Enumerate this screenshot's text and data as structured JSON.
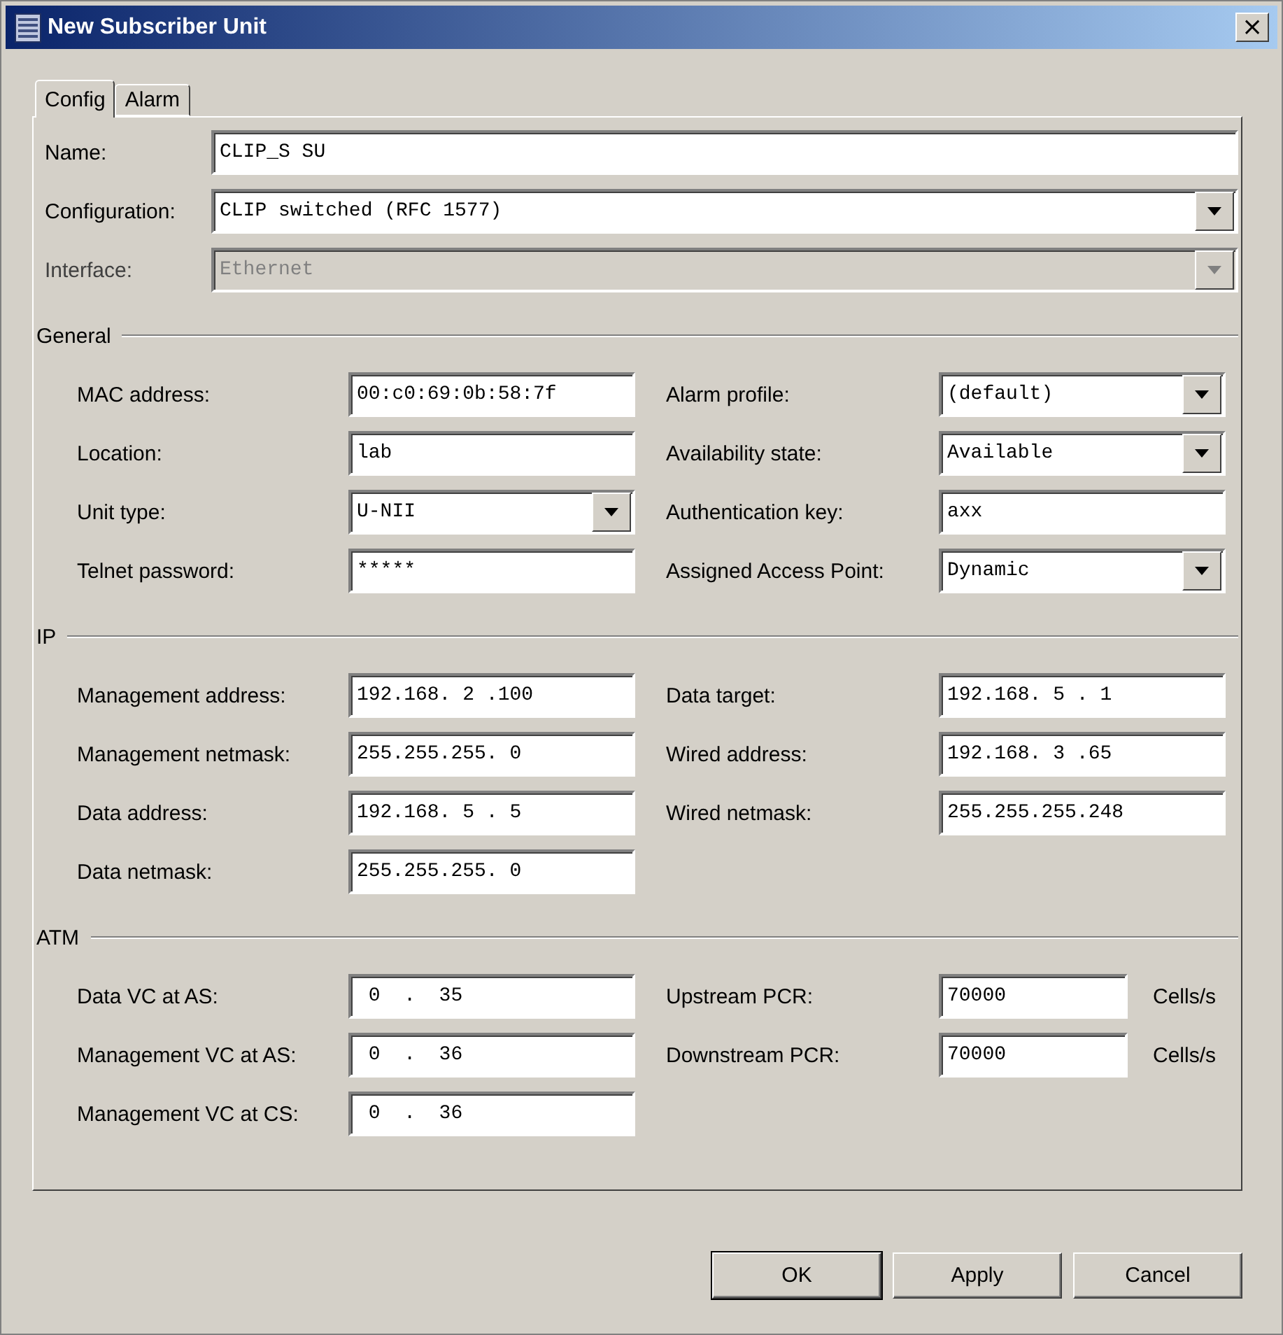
{
  "window": {
    "title": "New Subscriber Unit",
    "close": "×"
  },
  "tabs": [
    {
      "label": "Config",
      "selected": true
    },
    {
      "label": "Alarm",
      "selected": false
    }
  ],
  "top_fields": [
    {
      "label": "Name:",
      "kind": "text",
      "value": "CLIP_S SU",
      "disabled": false
    },
    {
      "label": "Configuration:",
      "kind": "combo",
      "value": "CLIP switched (RFC 1577)",
      "disabled": false
    },
    {
      "label": "Interface:",
      "kind": "combo",
      "value": "Ethernet",
      "disabled": true
    }
  ],
  "sections": [
    {
      "title": "General",
      "left": [
        {
          "label": "MAC address:",
          "kind": "text",
          "value": "00:c0:69:0b:58:7f"
        },
        {
          "label": "Location:",
          "kind": "text",
          "value": "lab"
        },
        {
          "label": "Unit type:",
          "kind": "combo",
          "value": "U-NII"
        },
        {
          "label": "Telnet password:",
          "kind": "text",
          "value": "*****"
        }
      ],
      "right": [
        {
          "label": "Alarm profile:",
          "kind": "combo",
          "value": "(default)"
        },
        {
          "label": "Availability state:",
          "kind": "combo",
          "value": "Available"
        },
        {
          "label": "Authentication key:",
          "kind": "text",
          "value": "axx"
        },
        {
          "label": "Assigned Access Point:",
          "kind": "combo",
          "value": "Dynamic"
        }
      ]
    },
    {
      "title": "IP",
      "left": [
        {
          "label": "Management address:",
          "kind": "text",
          "value": "192.168. 2 .100"
        },
        {
          "label": "Management netmask:",
          "kind": "text",
          "value": "255.255.255. 0"
        },
        {
          "label": "Data address:",
          "kind": "text",
          "value": "192.168. 5 . 5"
        },
        {
          "label": "Data netmask:",
          "kind": "text",
          "value": "255.255.255. 0"
        }
      ],
      "right": [
        {
          "label": "Data target:",
          "kind": "text",
          "value": "192.168. 5 . 1"
        },
        {
          "label": "Wired address:",
          "kind": "text",
          "value": "192.168. 3 .65"
        },
        {
          "label": "Wired netmask:",
          "kind": "text",
          "value": "255.255.255.248"
        }
      ]
    },
    {
      "title": "ATM",
      "left": [
        {
          "label": "Data VC at AS:",
          "kind": "text",
          "value": " 0  .  35"
        },
        {
          "label": "Management VC at AS:",
          "kind": "text",
          "value": " 0  .  36"
        },
        {
          "label": "Management VC at CS:",
          "kind": "text",
          "value": " 0  .  36"
        }
      ],
      "right": [
        {
          "label": "Upstream PCR:",
          "kind": "text",
          "value": "70000",
          "unit": "Cells/s"
        },
        {
          "label": "Downstream PCR:",
          "kind": "text",
          "value": "70000",
          "unit": "Cells/s"
        }
      ]
    }
  ],
  "buttons": [
    "OK",
    "Apply",
    "Cancel"
  ]
}
